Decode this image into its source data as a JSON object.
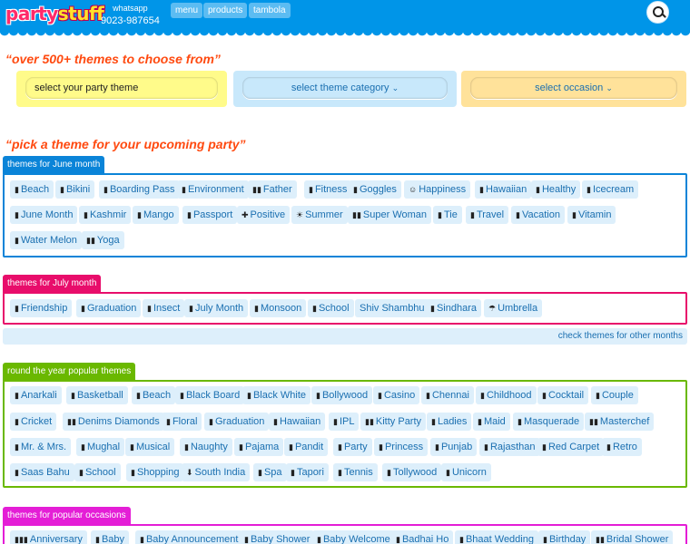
{
  "header": {
    "logo_part1": "party",
    "logo_part2": "stuff",
    "whatsapp_label": "whatsapp",
    "phone": "9023-987654",
    "nav": [
      "menu",
      "products",
      "tambola"
    ],
    "search_icon": "search-icon"
  },
  "headings": {
    "themes_count": "“over 500+ themes to choose from”",
    "pick_theme": "“pick a theme for your upcoming party”"
  },
  "selectors": {
    "theme": "select your party theme",
    "category": "select theme category",
    "occasion": "select occasion"
  },
  "colors": {
    "topbar": "#0095e8",
    "june": "#0a84d8",
    "july": "#e80d6b",
    "year": "#6ab800",
    "occasions": "#e41ed6",
    "heading": "#ff4a10",
    "chip_bg": "#ddeffb",
    "chip_text": "#1a6fb0"
  },
  "sections": {
    "june": {
      "label": "themes for June month",
      "rows": [
        [
          "Beach",
          "Bikini",
          "Boarding Pass",
          "Environment",
          "Father",
          "Fitness",
          "Goggles",
          "Happiness",
          "Hawaiian",
          "Healthy",
          "Icecream"
        ],
        [
          "June Month",
          "Kashmir",
          "Mango",
          "Passport",
          "Positive",
          "Summer",
          "Super Woman",
          "Tie",
          "Travel",
          "Vacation",
          "Vitamin"
        ],
        [
          "Water Melon",
          "Yoga"
        ]
      ]
    },
    "july": {
      "label": "themes for July month",
      "rows": [
        [
          "Friendship",
          "Graduation",
          "Insect",
          "July Month",
          "Monsoon",
          "School",
          "Shiv Shambhu",
          "Sindhara",
          "Umbrella"
        ]
      ]
    },
    "other_months_link": "check themes for other months",
    "year": {
      "label": "round the year popular themes",
      "rows": [
        [
          "Anarkali",
          "Basketball",
          "Beach",
          "Black Board",
          "Black White",
          "Bollywood",
          "Casino",
          "Chennai",
          "Childhood",
          "Cocktail",
          "Couple"
        ],
        [
          "Cricket",
          "Denims Diamonds",
          "Floral",
          "Graduation",
          "Hawaiian",
          "IPL",
          "Kitty Party",
          "Ladies",
          "Maid",
          "Masquerade",
          "Masterchef"
        ],
        [
          "Mr. & Mrs.",
          "Mughal",
          "Musical",
          "Naughty",
          "Pajama",
          "Pandit",
          "Party",
          "Princess",
          "Punjab",
          "Rajasthan",
          "Red Carpet",
          "Retro"
        ],
        [
          "Saas Bahu",
          "School",
          "Shopping",
          "South India",
          "Spa",
          "Tapori",
          "Tennis",
          "Tollywood",
          "Unicorn"
        ]
      ]
    },
    "occasions": {
      "label": "themes for popular occasions",
      "rows": [
        [
          "Anniversary",
          "Baby",
          "Baby Announcement",
          "Baby Shower",
          "Baby Welcome",
          "Badhai Ho",
          "Bhaat Wedding",
          "Birthday",
          "Bridal Shower"
        ]
      ]
    }
  }
}
